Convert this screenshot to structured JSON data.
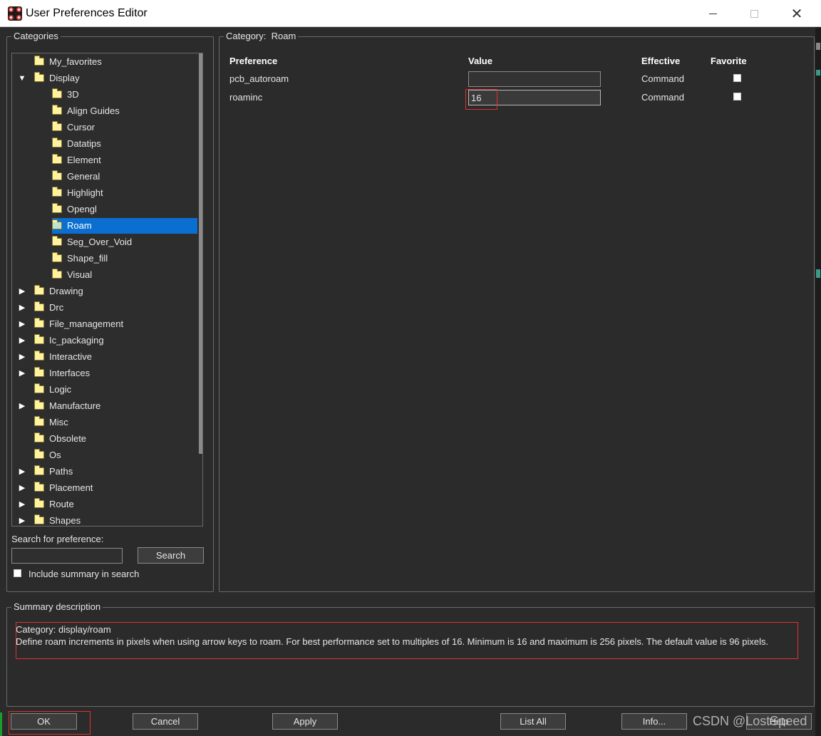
{
  "window": {
    "title": "User Preferences Editor"
  },
  "categories": {
    "title": "Categories",
    "tree": [
      {
        "label": "My_favorites",
        "level": 0,
        "arrow": "none"
      },
      {
        "label": "Display",
        "level": 0,
        "arrow": "down"
      },
      {
        "label": "3D",
        "level": 1,
        "arrow": "none"
      },
      {
        "label": "Align Guides",
        "level": 1,
        "arrow": "none"
      },
      {
        "label": "Cursor",
        "level": 1,
        "arrow": "none"
      },
      {
        "label": "Datatips",
        "level": 1,
        "arrow": "none"
      },
      {
        "label": "Element",
        "level": 1,
        "arrow": "none"
      },
      {
        "label": "General",
        "level": 1,
        "arrow": "none"
      },
      {
        "label": "Highlight",
        "level": 1,
        "arrow": "none"
      },
      {
        "label": "Opengl",
        "level": 1,
        "arrow": "none"
      },
      {
        "label": "Roam",
        "level": 1,
        "arrow": "none",
        "selected": true
      },
      {
        "label": "Seg_Over_Void",
        "level": 1,
        "arrow": "none"
      },
      {
        "label": "Shape_fill",
        "level": 1,
        "arrow": "none"
      },
      {
        "label": "Visual",
        "level": 1,
        "arrow": "none"
      },
      {
        "label": "Drawing",
        "level": 0,
        "arrow": "right"
      },
      {
        "label": "Drc",
        "level": 0,
        "arrow": "right"
      },
      {
        "label": "File_management",
        "level": 0,
        "arrow": "right"
      },
      {
        "label": "Ic_packaging",
        "level": 0,
        "arrow": "right"
      },
      {
        "label": "Interactive",
        "level": 0,
        "arrow": "right"
      },
      {
        "label": "Interfaces",
        "level": 0,
        "arrow": "right"
      },
      {
        "label": "Logic",
        "level": 0,
        "arrow": "none"
      },
      {
        "label": "Manufacture",
        "level": 0,
        "arrow": "right"
      },
      {
        "label": "Misc",
        "level": 0,
        "arrow": "none"
      },
      {
        "label": "Obsolete",
        "level": 0,
        "arrow": "none"
      },
      {
        "label": "Os",
        "level": 0,
        "arrow": "none"
      },
      {
        "label": "Paths",
        "level": 0,
        "arrow": "right"
      },
      {
        "label": "Placement",
        "level": 0,
        "arrow": "right"
      },
      {
        "label": "Route",
        "level": 0,
        "arrow": "right"
      },
      {
        "label": "Shapes",
        "level": 0,
        "arrow": "right"
      }
    ],
    "search_label": "Search for preference:",
    "search_value": "",
    "search_button": "Search",
    "include_summary_label": "Include summary in search"
  },
  "category_panel": {
    "title_prefix": "Category:",
    "title_value": "Roam",
    "headers": {
      "preference": "Preference",
      "value": "Value",
      "effective": "Effective",
      "favorite": "Favorite"
    },
    "rows": [
      {
        "preference": "pcb_autoroam",
        "value": "",
        "effective": "Command",
        "favorite": false
      },
      {
        "preference": "roaminc",
        "value": "16",
        "effective": "Command",
        "favorite": false
      }
    ]
  },
  "summary": {
    "title": "Summary description",
    "line1": "Category: display/roam",
    "line2": "Define roam increments in pixels when using arrow keys to roam. For best performance set to multiples of 16. Minimum is 16 and maximum is 256 pixels. The default value is 96 pixels."
  },
  "buttons": {
    "ok": "OK",
    "cancel": "Cancel",
    "apply": "Apply",
    "list_all": "List All",
    "info": "Info...",
    "help": "Help"
  },
  "watermark": "CSDN @LostSpeed",
  "colors": {
    "background": "#2b2b2b",
    "selection": "#0a6fd0",
    "highlight_box": "#e03030",
    "folder": "#fff2a0"
  }
}
